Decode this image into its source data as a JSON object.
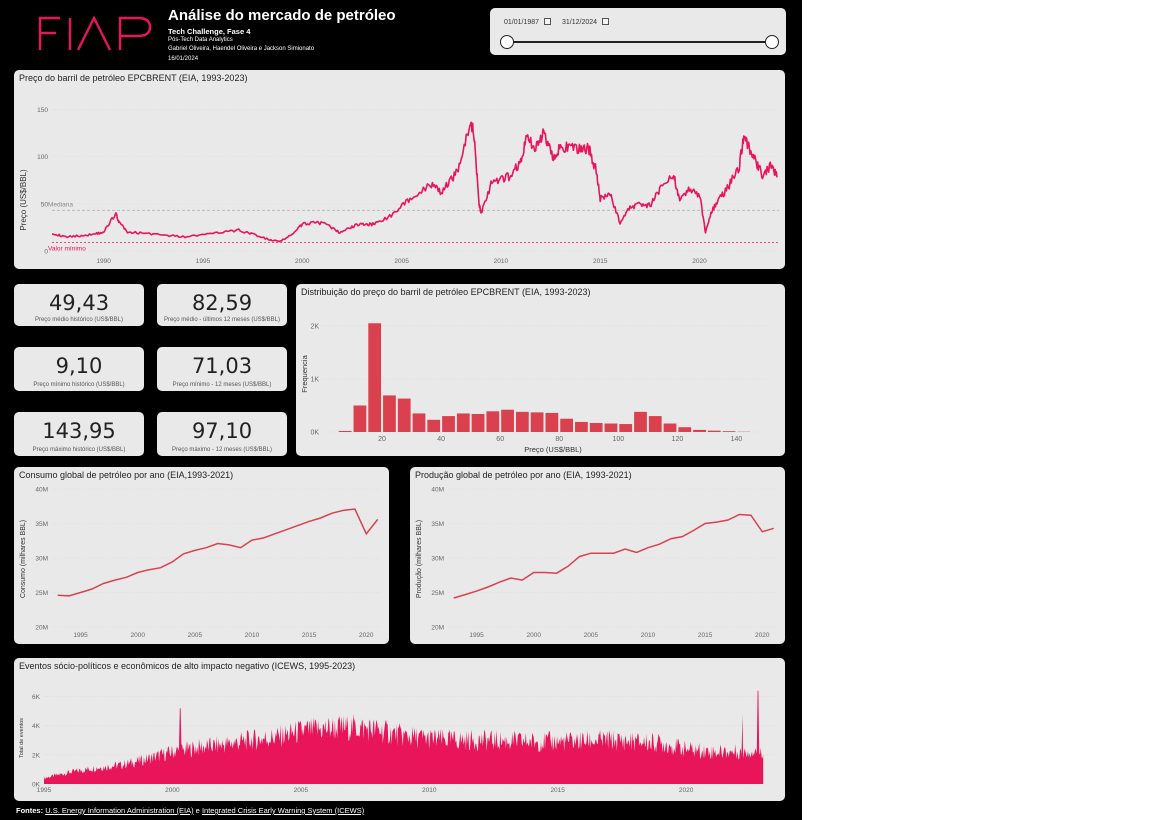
{
  "header": {
    "logo_text": "FIAP",
    "title": "Análise do mercado de petróleo",
    "subtitle": "Tech Challenge, Fase 4",
    "program": "Pós-Tech Data Analytics",
    "authors": "Gabriel Oliveira, Haendel Oliveira e Jackson Simionato",
    "date": "16/01/2024"
  },
  "slicer": {
    "start": "01/01/1987",
    "end": "31/12/2024"
  },
  "colors": {
    "accent": "#e8155b",
    "bar": "#d9414f",
    "card": "#e9e9e9"
  },
  "price_chart": {
    "title": "Preço do barril de petróleo EPCBRENT (EIA, 1993-2023)",
    "ylabel": "Preço (US$/BBL)",
    "median_label": "Mediana",
    "min_label": "Valor mínimo"
  },
  "kpis": [
    {
      "value": "49,43",
      "label": "Preço médio histórico (US$/BBL)"
    },
    {
      "value": "82,59",
      "label": "Preço médio - últimos 12 meses (US$/BBL)"
    },
    {
      "value": "9,10",
      "label": "Preço mínimo histórico (US$/BBL)"
    },
    {
      "value": "71,03",
      "label": "Preço mínimo - 12 meses (US$/BBL)"
    },
    {
      "value": "143,95",
      "label": "Preço máximo histórico (US$/BBL)"
    },
    {
      "value": "97,10",
      "label": "Preço máximo - 12 meses (US$/BBL)"
    }
  ],
  "hist_chart": {
    "title": "Distribuição do preço do barril de petróleo EPCBRENT (EIA, 1993-2023)",
    "xlabel": "Preço (US$/BBL)",
    "ylabel": "Frequencia"
  },
  "cons_chart": {
    "title": "Consumo global de petróleo por ano (EIA,1993-2021)",
    "ylabel": "Consumo (milhares BBL)"
  },
  "prod_chart": {
    "title": "Produção global de petróleo por ano (EIA, 1993-2021)",
    "ylabel": "Produção (milhares BBL)"
  },
  "events_chart": {
    "title": "Eventos sócio-políticos e econômicos de alto impacto negativo (ICEWS, 1995-2023)",
    "ylabel": "Total de eventos"
  },
  "footer": {
    "prefix": "Fontes:",
    "source1": "U.S. Energy Information Administration (EIA)",
    "conj": " e ",
    "source2": "Integrated Crisis Early Warning System (ICEWS)"
  },
  "chart_data": [
    {
      "type": "line",
      "title": "Preço do barril de petróleo EPCBRENT (EIA, 1993-2023)",
      "ylabel": "Preço (US$/BBL)",
      "xlim": [
        1987.4,
        2024.0
      ],
      "ylim": [
        0,
        160
      ],
      "yticks": [
        0,
        50,
        100,
        150
      ],
      "xticks": [
        1990,
        1995,
        2000,
        2005,
        2010,
        2015,
        2020
      ],
      "reference_lines": [
        {
          "name": "Mediana",
          "y": 43
        },
        {
          "name": "Valor mínimo",
          "y": 9.1
        }
      ],
      "x": [
        1987.4,
        1988.0,
        1988.8,
        1989.5,
        1990.0,
        1990.6,
        1990.8,
        1991.2,
        1992.0,
        1993.0,
        1994.0,
        1995.0,
        1996.0,
        1996.8,
        1997.5,
        1998.3,
        1998.9,
        1999.5,
        2000.0,
        2000.7,
        2001.3,
        2001.9,
        2002.5,
        2003.0,
        2003.5,
        2004.0,
        2004.8,
        2005.5,
        2006.5,
        2007.0,
        2007.5,
        2008.0,
        2008.5,
        2008.7,
        2008.9,
        2009.0,
        2009.5,
        2010.0,
        2010.5,
        2011.0,
        2011.3,
        2011.8,
        2012.2,
        2012.6,
        2013.0,
        2013.5,
        2014.0,
        2014.4,
        2014.8,
        2015.0,
        2015.5,
        2016.0,
        2016.5,
        2017.0,
        2017.5,
        2018.0,
        2018.7,
        2019.0,
        2019.5,
        2020.0,
        2020.3,
        2020.6,
        2021.0,
        2021.5,
        2022.0,
        2022.2,
        2022.5,
        2022.9,
        2023.2,
        2023.6,
        2023.9
      ],
      "y": [
        19,
        15,
        16,
        18,
        20,
        40,
        30,
        20,
        19,
        17,
        15,
        17,
        20,
        22,
        18,
        12,
        10,
        18,
        28,
        31,
        27,
        19,
        26,
        29,
        28,
        32,
        42,
        58,
        70,
        62,
        75,
        95,
        140,
        110,
        50,
        40,
        70,
        75,
        80,
        95,
        120,
        110,
        125,
        100,
        110,
        108,
        108,
        110,
        85,
        55,
        60,
        30,
        46,
        50,
        48,
        65,
        80,
        55,
        65,
        60,
        20,
        42,
        55,
        70,
        90,
        120,
        110,
        90,
        80,
        90,
        78
      ]
    },
    {
      "type": "bar",
      "title": "Distribuição do preço do barril de petróleo EPCBRENT (EIA, 1993-2023)",
      "xlabel": "Preço (US$/BBL)",
      "ylabel": "Frequencia",
      "bin_width": 5,
      "bin_starts": [
        5,
        10,
        15,
        20,
        25,
        30,
        35,
        40,
        45,
        50,
        55,
        60,
        65,
        70,
        75,
        80,
        85,
        90,
        95,
        100,
        105,
        110,
        115,
        120,
        125,
        130,
        135,
        140
      ],
      "values": [
        20,
        500,
        2050,
        690,
        630,
        350,
        230,
        300,
        350,
        340,
        390,
        420,
        380,
        370,
        360,
        250,
        190,
        170,
        160,
        150,
        380,
        300,
        160,
        90,
        40,
        25,
        15,
        5
      ],
      "xticks": [
        20,
        40,
        60,
        80,
        100,
        120,
        140
      ],
      "yticks": [
        0,
        1000,
        2000
      ],
      "ytick_labels": [
        "0K",
        "1K",
        "2K"
      ],
      "ylim": [
        0,
        2300
      ]
    },
    {
      "type": "line",
      "title": "Consumo global de petróleo por ano (EIA,1993-2021)",
      "ylabel": "Consumo (milhares BBL)",
      "x": [
        1993,
        1994,
        1995,
        1996,
        1997,
        1998,
        1999,
        2000,
        2001,
        2002,
        2003,
        2004,
        2005,
        2006,
        2007,
        2008,
        2009,
        2010,
        2011,
        2012,
        2013,
        2014,
        2015,
        2016,
        2017,
        2018,
        2019,
        2020,
        2021
      ],
      "y": [
        24.6,
        24.5,
        25.0,
        25.5,
        26.3,
        26.8,
        27.2,
        27.9,
        28.3,
        28.6,
        29.4,
        30.6,
        31.1,
        31.5,
        32.1,
        31.9,
        31.5,
        32.6,
        32.9,
        33.5,
        34.1,
        34.7,
        35.3,
        35.8,
        36.5,
        36.9,
        37.1,
        33.5,
        35.6
      ],
      "ylim": [
        20,
        40
      ],
      "yticks": [
        20,
        25,
        30,
        35,
        40
      ],
      "ytick_labels": [
        "20M",
        "25M",
        "30M",
        "35M",
        "40M"
      ],
      "xticks": [
        1995,
        2000,
        2005,
        2010,
        2015,
        2020
      ],
      "xlim": [
        1992.5,
        2021.2
      ]
    },
    {
      "type": "line",
      "title": "Produção global de petróleo por ano (EIA, 1993-2021)",
      "ylabel": "Produção (milhares BBL)",
      "x": [
        1993,
        1994,
        1995,
        1996,
        1997,
        1998,
        1999,
        2000,
        2001,
        2002,
        2003,
        2004,
        2005,
        2006,
        2007,
        2008,
        2009,
        2010,
        2011,
        2012,
        2013,
        2014,
        2015,
        2016,
        2017,
        2018,
        2019,
        2020,
        2021
      ],
      "y": [
        24.2,
        24.7,
        25.2,
        25.8,
        26.5,
        27.1,
        26.8,
        27.9,
        27.9,
        27.8,
        28.8,
        30.2,
        30.7,
        30.7,
        30.7,
        31.3,
        30.8,
        31.5,
        32.0,
        32.8,
        33.1,
        34.0,
        35.0,
        35.2,
        35.5,
        36.3,
        36.2,
        33.8,
        34.3
      ],
      "ylim": [
        20,
        40
      ],
      "yticks": [
        20,
        25,
        30,
        35,
        40
      ],
      "ytick_labels": [
        "20M",
        "25M",
        "30M",
        "35M",
        "40M"
      ],
      "xticks": [
        1995,
        2000,
        2005,
        2010,
        2015,
        2020
      ],
      "xlim": [
        1992.5,
        2021.2
      ]
    },
    {
      "type": "area",
      "title": "Eventos sócio-políticos e econômicos de alto impacto negativo (ICEWS, 1995-2023)",
      "ylabel": "Total de eventos",
      "xlim": [
        1995,
        2023.5
      ],
      "ylim": [
        0,
        7000
      ],
      "yticks": [
        0,
        2000,
        4000,
        6000
      ],
      "ytick_labels": [
        "0K",
        "2K",
        "4K",
        "6K"
      ],
      "xticks": [
        1995,
        2000,
        2005,
        2010,
        2015,
        2020
      ],
      "trend_x": [
        1995,
        1996,
        1997,
        1998,
        1999,
        2000,
        2001,
        2002,
        2003,
        2004,
        2005,
        2006,
        2007,
        2008,
        2009,
        2010,
        2011,
        2012,
        2013,
        2014,
        2015,
        2016,
        2017,
        2018,
        2019,
        2020,
        2021,
        2022,
        2023
      ],
      "trend_y": [
        400,
        800,
        1100,
        1300,
        1700,
        2200,
        2500,
        2700,
        3000,
        3200,
        3600,
        3800,
        3900,
        3700,
        3300,
        3100,
        3000,
        3000,
        2950,
        2900,
        2900,
        2950,
        3000,
        2900,
        2800,
        2400,
        2200,
        2200,
        2300
      ],
      "spikes": [
        {
          "x": 2000.3,
          "y": 5200
        },
        {
          "x": 2022.2,
          "y": 4800
        },
        {
          "x": 2022.8,
          "y": 6400
        }
      ]
    }
  ]
}
